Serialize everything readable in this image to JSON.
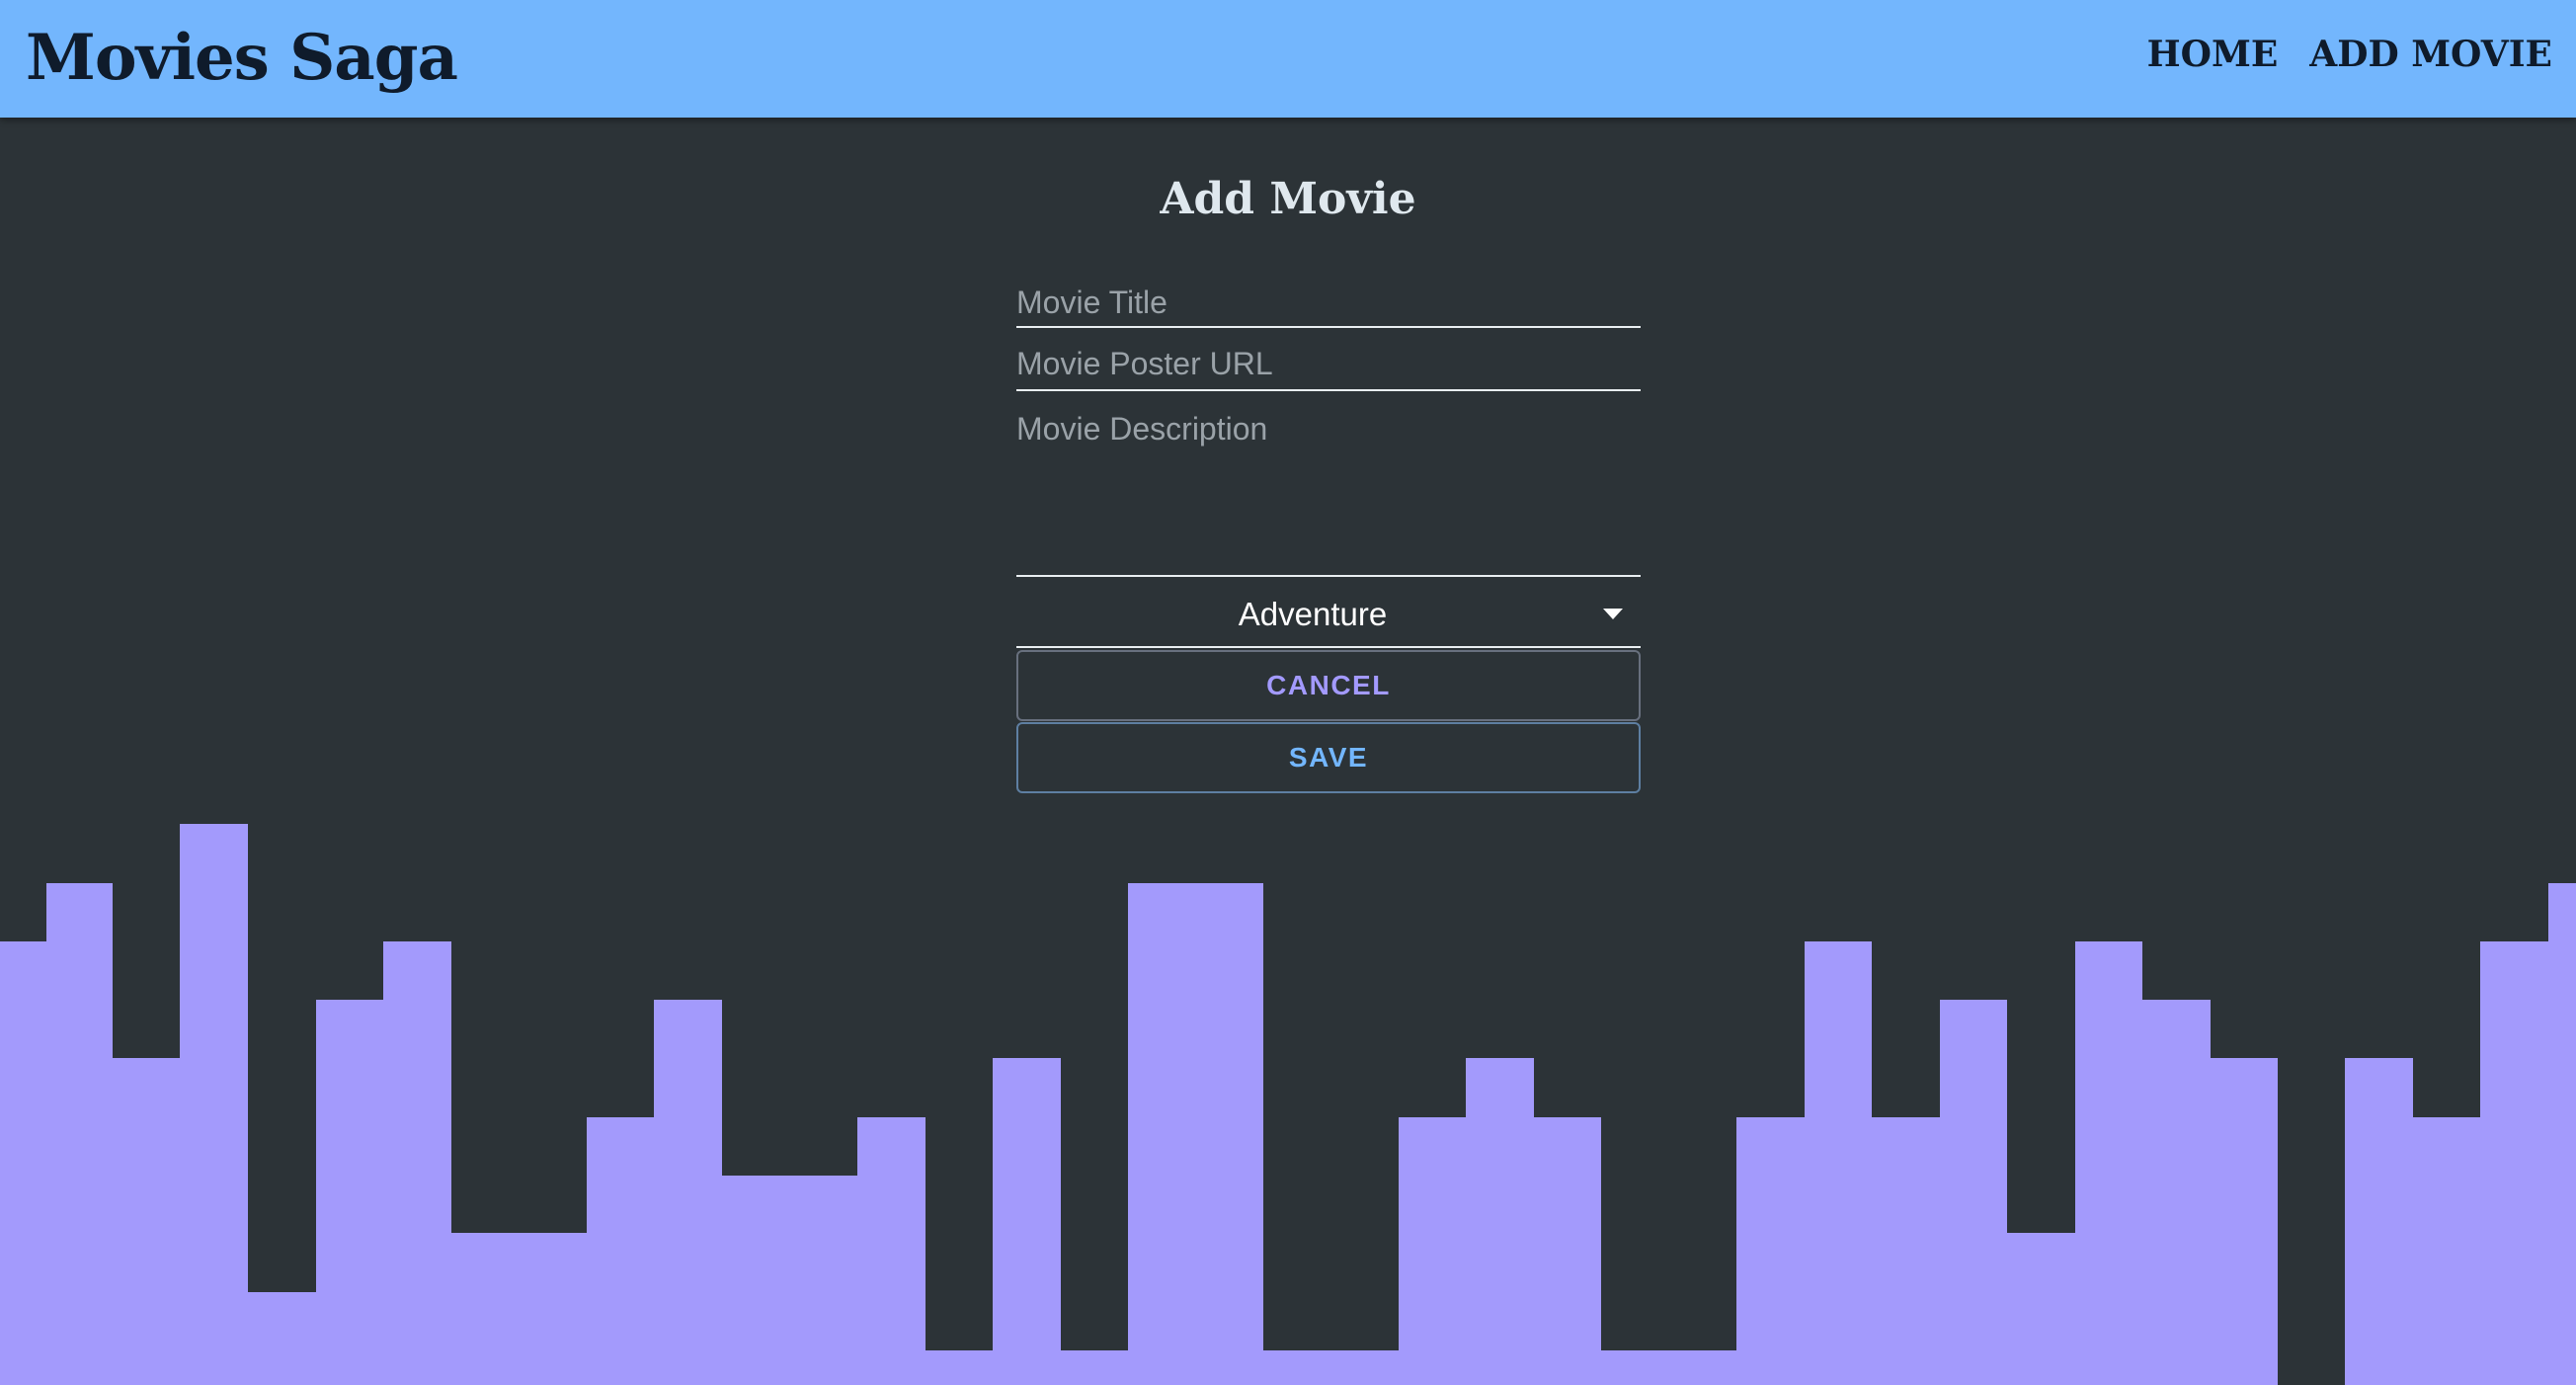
{
  "app": {
    "brand": "Movies Saga"
  },
  "nav": {
    "home": "HOME",
    "add_movie": "ADD MOVIE"
  },
  "form": {
    "heading": "Add Movie",
    "title_placeholder": "Movie Title",
    "poster_placeholder": "Movie Poster URL",
    "description_placeholder": "Movie Description",
    "genre_selected": "Adventure",
    "cancel_label": "CANCEL",
    "save_label": "SAVE"
  },
  "colors": {
    "header_bg": "#73b6fd",
    "page_bg": "#2c3337",
    "skyline": "#a39afc",
    "cancel_text": "#a39aff",
    "save_text": "#73b6fd"
  }
}
